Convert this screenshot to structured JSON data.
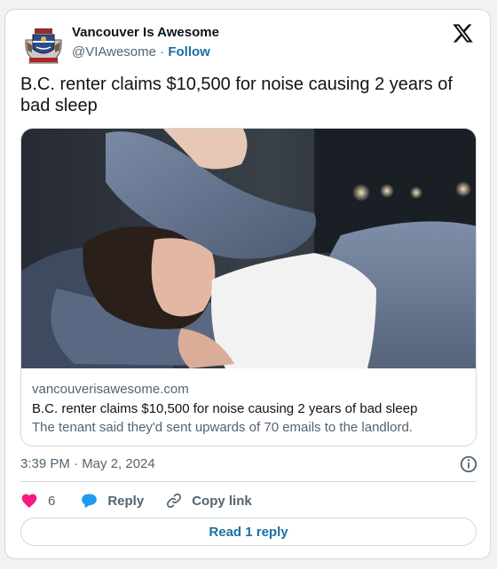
{
  "author": {
    "name": "Vancouver Is Awesome",
    "handle": "@VIAwesome",
    "separator": " · ",
    "follow_label": "Follow"
  },
  "tweet": {
    "text": "B.C. renter claims $10,500 for noise causing 2 years of bad sleep"
  },
  "link_card": {
    "domain": "vancouverisawesome.com",
    "title": "B.C. renter claims $10,500 for noise causing 2 years of bad sleep",
    "description": "The tenant said they'd sent upwards of 70 emails to the landlord."
  },
  "meta": {
    "timestamp": "3:39 PM · May 2, 2024"
  },
  "actions": {
    "likes_count": "6",
    "reply_label": "Reply",
    "copy_label": "Copy link"
  },
  "footer": {
    "read_reply_label": "Read 1 reply"
  },
  "colors": {
    "text": "#0f1419",
    "muted": "#536471",
    "link": "#1d6fa5",
    "like": "#f91880",
    "reply": "#1d9bf0",
    "border": "#cfd9de"
  },
  "icons": [
    "crest-avatar-icon",
    "x-logo-icon",
    "info-icon",
    "heart-icon",
    "reply-bubble-icon",
    "copy-link-icon"
  ]
}
